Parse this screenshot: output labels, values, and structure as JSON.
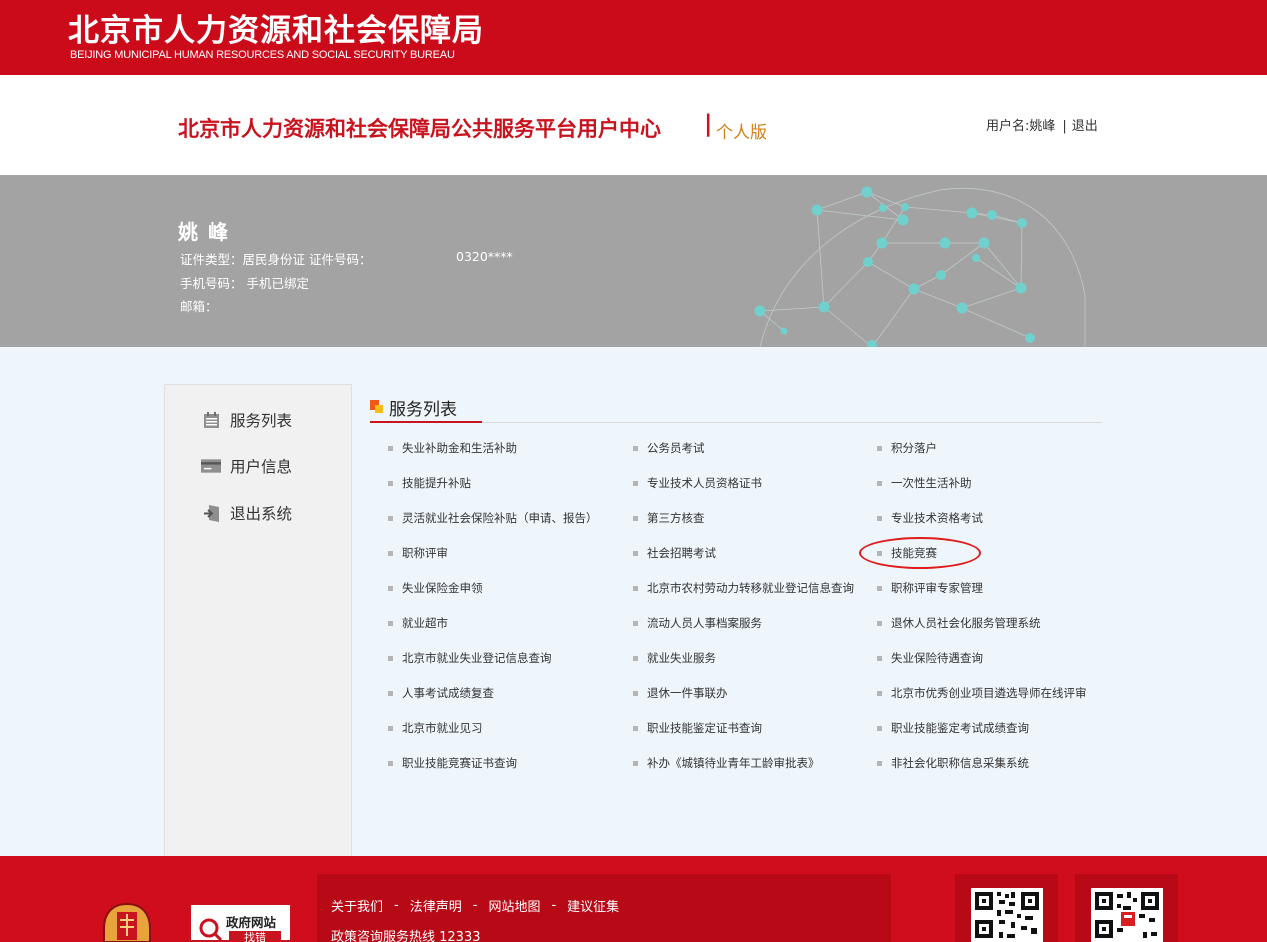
{
  "banner": {
    "title_cn": "北京市人力资源和社会保障局",
    "title_en": "BEIJING MUNICIPAL HUMAN RESOURCES AND SOCIAL SECURITY BUREAU"
  },
  "header": {
    "platform_title": "北京市人力资源和社会保障局公共服务平台用户中心",
    "separator": "|",
    "edition": "个人版",
    "username_label": "用户名:姚峰",
    "divider": "|",
    "logout": "退出"
  },
  "profile": {
    "name": "姚峰",
    "id_line": "证件类型：居民身份证  证件号码：",
    "id_number": "0320****",
    "phone_line": "手机号码：  手机已绑定",
    "email_line": "邮箱："
  },
  "sidebar": {
    "items": [
      {
        "label": "服务列表",
        "icon": "list-icon"
      },
      {
        "label": "用户信息",
        "icon": "id-card-icon"
      },
      {
        "label": "退出系统",
        "icon": "exit-icon"
      }
    ]
  },
  "services": {
    "title": "服务列表",
    "columns": [
      [
        "失业补助金和生活补助",
        "技能提升补贴",
        "灵活就业社会保险补贴（申请、报告）",
        "职称评审",
        "失业保险金申领",
        "就业超市",
        "北京市就业失业登记信息查询",
        "人事考试成绩复查",
        "北京市就业见习",
        "职业技能竞赛证书查询"
      ],
      [
        "公务员考试",
        "专业技术人员资格证书",
        "第三方核查",
        "社会招聘考试",
        "北京市农村劳动力转移就业登记信息查询",
        "流动人员人事档案服务",
        "就业失业服务",
        "退休一件事联办",
        "职业技能鉴定证书查询",
        "补办《城镇待业青年工龄审批表》"
      ],
      [
        "积分落户",
        "一次性生活补助",
        "专业技术资格考试",
        "技能竞赛",
        "职称评审专家管理",
        "退休人员社会化服务管理系统",
        "失业保险待遇查询",
        "北京市优秀创业项目遴选导师在线评审",
        "职业技能鉴定考试成绩查询",
        "非社会化职称信息采集系统"
      ]
    ],
    "highlighted": "技能竞赛"
  },
  "footer": {
    "links": [
      "关于我们",
      "法律声明",
      "网站地图",
      "建议征集"
    ],
    "link_separator": "-",
    "hotline": "政策咨询服务热线 12333",
    "gov_badge_text": "政府网站",
    "gov_badge_button": "找错"
  },
  "colors": {
    "brand_red": "#cc0b1a",
    "title_red": "#c8141e",
    "edition_orange": "#d4801a",
    "profile_grey": "#a3a3a3",
    "page_bg": "#eef6fc"
  }
}
